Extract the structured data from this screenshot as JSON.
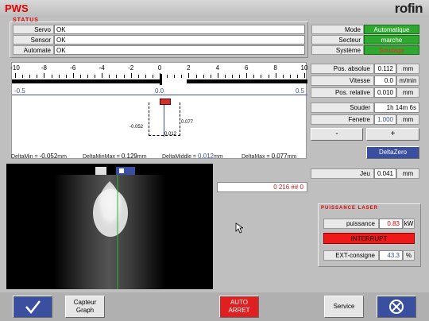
{
  "header": {
    "app": "PWS",
    "brand": "rofin",
    "status_title": "STATUS"
  },
  "status": [
    {
      "label": "Servo",
      "value": "OK"
    },
    {
      "label": "Sensor",
      "value": "OK"
    },
    {
      "label": "Automate",
      "value": "OK"
    }
  ],
  "mode": [
    {
      "label": "Mode",
      "value": "Automatique"
    },
    {
      "label": "Secteur",
      "value": "marche"
    },
    {
      "label": "Système",
      "value": "Soudage"
    }
  ],
  "scale": {
    "ticks": [
      "-10",
      "-8",
      "-6",
      "-4",
      "-2",
      "0",
      "2",
      "4",
      "6",
      "8",
      "10"
    ],
    "sub_left": "-0.5",
    "sub_mid": "0.0",
    "sub_right": "0.5",
    "detail_left": "-0.052",
    "detail_right": "0.077",
    "detail_bottom": "0.012"
  },
  "readouts": [
    {
      "label": "Pos. absolue",
      "value": "0.112",
      "unit": "mm"
    },
    {
      "label": "Vitesse",
      "value": "0.0",
      "unit": "m/min"
    },
    {
      "label": "Pos. relative",
      "value": "0.010",
      "unit": "mm"
    }
  ],
  "souder": {
    "label": "Souder",
    "value": "1h 14m 6s"
  },
  "fenetre": {
    "label": "Fenetre",
    "value": "1.000",
    "unit": "mm"
  },
  "buttons": {
    "minus": "-",
    "plus": "+",
    "deltazero": "DeltaZero"
  },
  "deltas": [
    {
      "label": "DeltaMin =",
      "value": "-0.052",
      "unit": "mm"
    },
    {
      "label": "DeltaMinMax =",
      "value": "0.129",
      "unit": "mm"
    },
    {
      "label": "DeltaMiddle =",
      "value": "0.012",
      "unit": "mm"
    },
    {
      "label": "DeltaMax =",
      "value": "0.077",
      "unit": "mm"
    }
  ],
  "jeu": {
    "label": "Jeu",
    "value": "0.041",
    "unit": "mm"
  },
  "readout_field": "0 216 ## 0",
  "laser": {
    "title": "PUISSANCE LASER",
    "puissance_label": "puissance",
    "puissance_value": "0.83",
    "puissance_unit": "kW",
    "interrupt": "INTERRUPT",
    "ext_label": "EXT-consigne",
    "ext_value": "43.3",
    "ext_unit": "%"
  },
  "footer": {
    "capteur_line1": "Capteur",
    "capteur_line2": "Graph",
    "auto_line1": "AUTO",
    "auto_line2": "ARRET",
    "service": "Service"
  },
  "colors": {
    "accent_red": "#e00000",
    "status_green": "#2ea82e",
    "deltazero_blue": "#3a4fa0"
  }
}
